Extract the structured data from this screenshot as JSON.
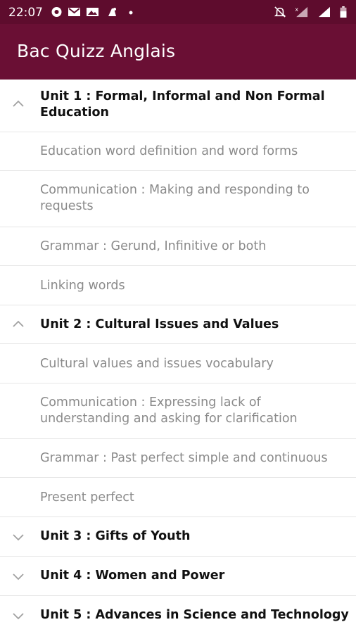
{
  "status": {
    "time": "22:07"
  },
  "app": {
    "title": "Bac Quizz Anglais"
  },
  "units": [
    {
      "title": "Unit 1 : Formal, Informal and Non Formal Education",
      "expanded": true,
      "items": [
        "Education word definition and word forms",
        "Communication : Making and responding to requests",
        "Grammar : Gerund, Infinitive or both",
        "Linking words"
      ]
    },
    {
      "title": "Unit 2 : Cultural Issues and Values",
      "expanded": true,
      "items": [
        "Cultural values and issues vocabulary",
        "Communication : Expressing lack of understanding and asking for clarification",
        "Grammar : Past perfect simple and continuous",
        "Present perfect"
      ]
    },
    {
      "title": "Unit 3 : Gifts of Youth",
      "expanded": false,
      "items": []
    },
    {
      "title": "Unit 4 : Women and Power",
      "expanded": false,
      "items": []
    },
    {
      "title": "Unit 5 : Advances in Science and Technology",
      "expanded": false,
      "items": []
    }
  ]
}
